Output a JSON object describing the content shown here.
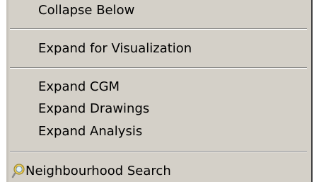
{
  "menu": {
    "items": [
      {
        "label": "Collapse Below"
      },
      {
        "label": "Expand for Visualization"
      },
      {
        "label": "Expand CGM"
      },
      {
        "label": "Expand Drawings"
      },
      {
        "label": "Expand Analysis"
      },
      {
        "label": "Neighbourhood Search",
        "icon": "magnifier-search-icon"
      }
    ]
  }
}
